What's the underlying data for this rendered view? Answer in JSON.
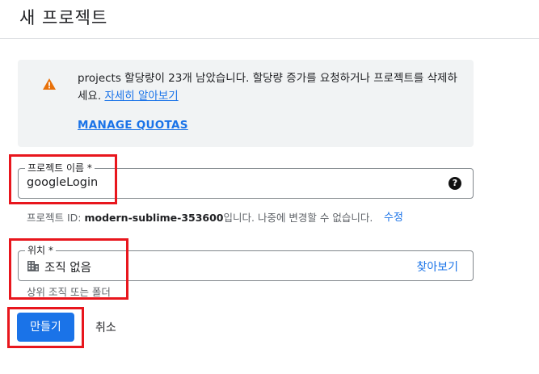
{
  "header": {
    "title": "새 프로젝트"
  },
  "alert": {
    "message": "projects 할당량이 23개 남았습니다. 할당량 증가를 요청하거나 프로젝트를 삭제하세요.",
    "link": "자세히 알아보기",
    "manage_label": "MANAGE QUOTAS",
    "icon": "warning-icon",
    "icon_color": "#e8710a"
  },
  "project_name": {
    "label": "프로젝트 이름 *",
    "value": "googleLogin",
    "icon": "help-icon"
  },
  "project_id": {
    "prefix": "프로젝트 ID:",
    "id": "modern-sublime-353600",
    "suffix": "입니다. 나중에 변경할 수 없습니다.",
    "edit_label": "수정"
  },
  "location": {
    "label": "위치 *",
    "value": "조직 없음",
    "browse_label": "찾아보기",
    "helper": "상위 조직 또는 폴더",
    "icon": "organization-icon"
  },
  "actions": {
    "create_label": "만들기",
    "cancel_label": "취소"
  },
  "colors": {
    "accent": "#1a73e8",
    "highlight": "#e8161d"
  }
}
